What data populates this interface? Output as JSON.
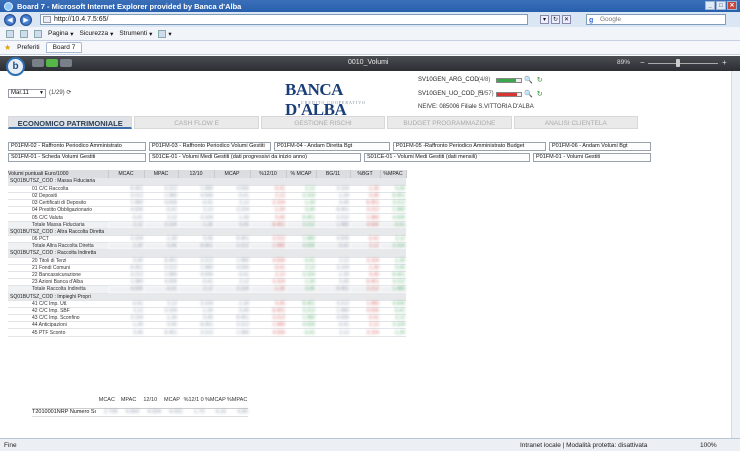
{
  "browser": {
    "window_title": "Board 7 - Microsoft Internet Explorer provided by Banca d'Alba",
    "address": "http://10.4.7.5:65/",
    "search_placeholder": "Google",
    "menu": {
      "page": "Pagina",
      "safety": "Sicurezza",
      "tools": "Strumenti"
    },
    "favorites": "Preferiti",
    "tab_title": "Board 7"
  },
  "app": {
    "screen_title": "0010_Volumi",
    "zoom": "89%",
    "period": "Mar.11",
    "counter": "(1/29)",
    "logo": {
      "word": "BANCA D'ALBA",
      "sub": "CREDITO COOPERATIVO"
    },
    "kpis": [
      {
        "label": "SV10GEN_ARG_COD",
        "count": "(4/8)",
        "fill": 0.8,
        "color": "#3aa84a"
      },
      {
        "label": "SV10GEN_UO_COD_FI",
        "count": "(5/57)",
        "fill": 0.85,
        "color": "#d93535"
      }
    ],
    "branch": "NEIVE: 085006 Filiale S.VITTORIA D'ALBA",
    "nav": [
      "ECONOMICO PATRIMONIALE",
      "CASH FLOW E",
      "GESTIONE RISCHI",
      "BUDGET PROGRAMMAZIONE",
      "ANALISI CLIENTELA"
    ],
    "reports_row1": [
      "P01FM-02 - Raffronto Periodico Amministrato",
      "P01FM-03 - Raffronto Periodico Volumi Gestiti",
      "P01FM-04 - Andam Diretta Bgt",
      "P01FM-05 -Raffronto Periodico Amministrato Budget",
      "P01FM-06 - Andam Volumi Bgt"
    ],
    "reports_row2": [
      "S01FM-01 - Scheda Volumi Gestiti",
      "S01CE-01 - Volumi Medi Gestiti (dati progressivi da inizio anno)",
      "S01CE-01 - Volumi Medi Gestiti (dati mensili)",
      "P01FM-01 - Volumi Gestiti"
    ]
  },
  "grid": {
    "columns": [
      "Volumi puntuali Euro/1000",
      "MCAC",
      "MPAC",
      "12/10",
      "MCAP",
      "%12/10",
      "% MCAP",
      "BG/11",
      "%BGT",
      "%MPAC"
    ],
    "groups": [
      {
        "name": "SQ01BUTSZ_COD : Massa Fiduciaria",
        "rows": [
          "01 C/C Raccolta",
          "02 Depositi",
          "03 Certificati di Deposito",
          "04 Prestito Obbligazionario",
          "05 C/C Valuta"
        ],
        "total": "Totale Massa Fiduciaria"
      },
      {
        "name": "SQ01BUTSZ_COD : Altra Raccolta Diretta",
        "rows": [
          "06 PCT"
        ],
        "total": "Totale Altra Raccolta Diretta"
      },
      {
        "name": "SQ01BUTSZ_COD : Raccolta Indiretta",
        "rows": [
          "20 Titoli di Terzi",
          "21 Fondi Comuni",
          "22 Bancassicurazione",
          "23 Azioni Banca d'Alba"
        ],
        "total": "Totale Raccolta Indiretta"
      },
      {
        "name": "SQ01BUTSZ_COD : Impieghi Propri",
        "rows": [
          "41 C/C Imp. Utl.",
          "42 C/C Imp. SBF",
          "43 C/C Imp. Sconfino",
          "44 Anticipazioni",
          "45 PTF Sconto"
        ],
        "total": ""
      }
    ],
    "sample_values": [
      "8.451",
      "3.212",
      "1.980",
      "4.506",
      "-0,41",
      "2,12",
      "3.104",
      "-1,30",
      "0,45"
    ]
  },
  "summary": {
    "columns": [
      "",
      "MCAC",
      "MPAC",
      "12/10",
      "MCAP",
      "%12/1 0",
      "%MCAP",
      "%MPAC"
    ],
    "row_label": "T2010001NRP Numero Soci",
    "values": [
      "2.706",
      "4.669",
      "4.004",
      "4.001",
      "1,70",
      "4,16",
      "4,80"
    ]
  },
  "status": {
    "left": "Fine",
    "zone": "Intranet locale | Modalità protetta: disattivata",
    "zoom": "100%"
  }
}
